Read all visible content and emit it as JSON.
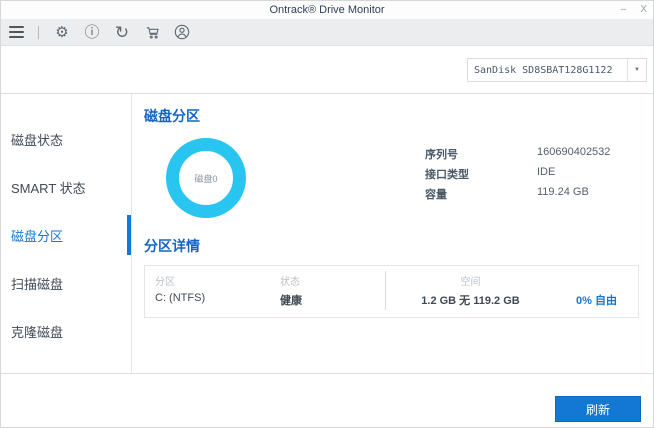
{
  "window": {
    "title": "Ontrack® Drive Monitor",
    "minimize": "–",
    "close": "X"
  },
  "toolbar": {
    "icons": [
      {
        "name": "menu-icon"
      },
      {
        "name": "settings-gear-icon",
        "glyph": "⚙"
      },
      {
        "name": "info-icon",
        "glyph": "ⓘ"
      },
      {
        "name": "refresh-icon",
        "glyph": "↻"
      },
      {
        "name": "cart-icon"
      },
      {
        "name": "user-icon"
      }
    ]
  },
  "drive_selector": {
    "value": "SanDisk SD8SBAT128G1122",
    "arrow": "▼"
  },
  "sidebar": {
    "items": [
      {
        "label": "磁盘状态",
        "active": false
      },
      {
        "label": "SMART 状态",
        "active": false
      },
      {
        "label": "磁盘分区",
        "active": true
      },
      {
        "label": "扫描磁盘",
        "active": false
      },
      {
        "label": "克隆磁盘",
        "active": false
      }
    ]
  },
  "main": {
    "section_title": "磁盘分区",
    "donut_label": "磁盘0",
    "info": [
      {
        "label": "序列号",
        "value": "160690402532"
      },
      {
        "label": "接口类型",
        "value": "IDE"
      },
      {
        "label": "容量",
        "value": "119.24 GB"
      }
    ],
    "details_title": "分区详情",
    "table": {
      "headers": [
        "分区",
        "状态",
        "空间"
      ],
      "row": {
        "partition": "C: (NTFS)",
        "status": "健康",
        "space": "1.2 GB 无 119.2 GB",
        "free": "0% 自由"
      }
    }
  },
  "footer": {
    "refresh_label": "刷新"
  },
  "colors": {
    "accent_blue": "#1377d4",
    "heading_blue": "#1466c0",
    "donut_cyan": "#29c5f1",
    "toolbar_bg": "#ecedef"
  },
  "chart_data": {
    "type": "pie",
    "title": "磁盘0",
    "slices": [
      {
        "label": "C: (NTFS)",
        "value": 100,
        "color": "#29c5f1"
      }
    ],
    "style": "donut",
    "legend_position": "none"
  }
}
